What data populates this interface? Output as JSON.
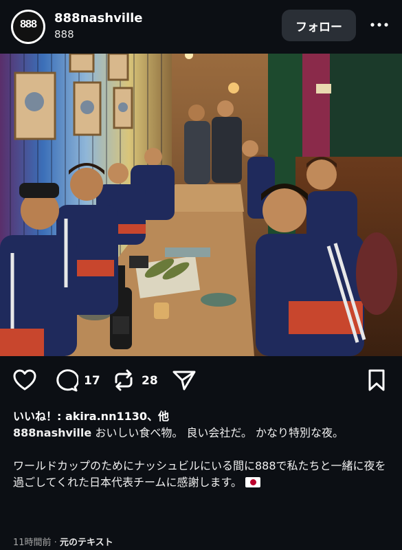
{
  "header": {
    "username": "888nashville",
    "subtitle": "888",
    "avatar_text": "888",
    "follow_label": "フォロー"
  },
  "post": {
    "comments_count": "17",
    "reposts_count": "28",
    "liked_by_prefix": "いいね！: ",
    "liked_by_user": "akira.nn1130",
    "liked_by_suffix": "、他",
    "caption_user": "888nashville",
    "caption_line1": " おいしい食べ物。 良い会社だ。 かなり特別な夜。",
    "caption_line2": "ワールドカップのためにナッシュビルにいる間に888で私たちと一緒に夜を過ごしてくれた日本代表チームに感謝します。",
    "time_ago": "11時間前",
    "separator": " · ",
    "translate_label": "元のテキスト"
  },
  "icons": {
    "like": "heart-icon",
    "comment": "comment-icon",
    "repost": "repost-icon",
    "share": "send-icon",
    "save": "bookmark-icon",
    "more": "more-icon",
    "flag": "japan-flag-icon"
  },
  "colors": {
    "background": "#0c0f14",
    "button": "#2a2f36",
    "jersey_blue": "#1f2a5c",
    "jersey_red": "#c8462d"
  }
}
